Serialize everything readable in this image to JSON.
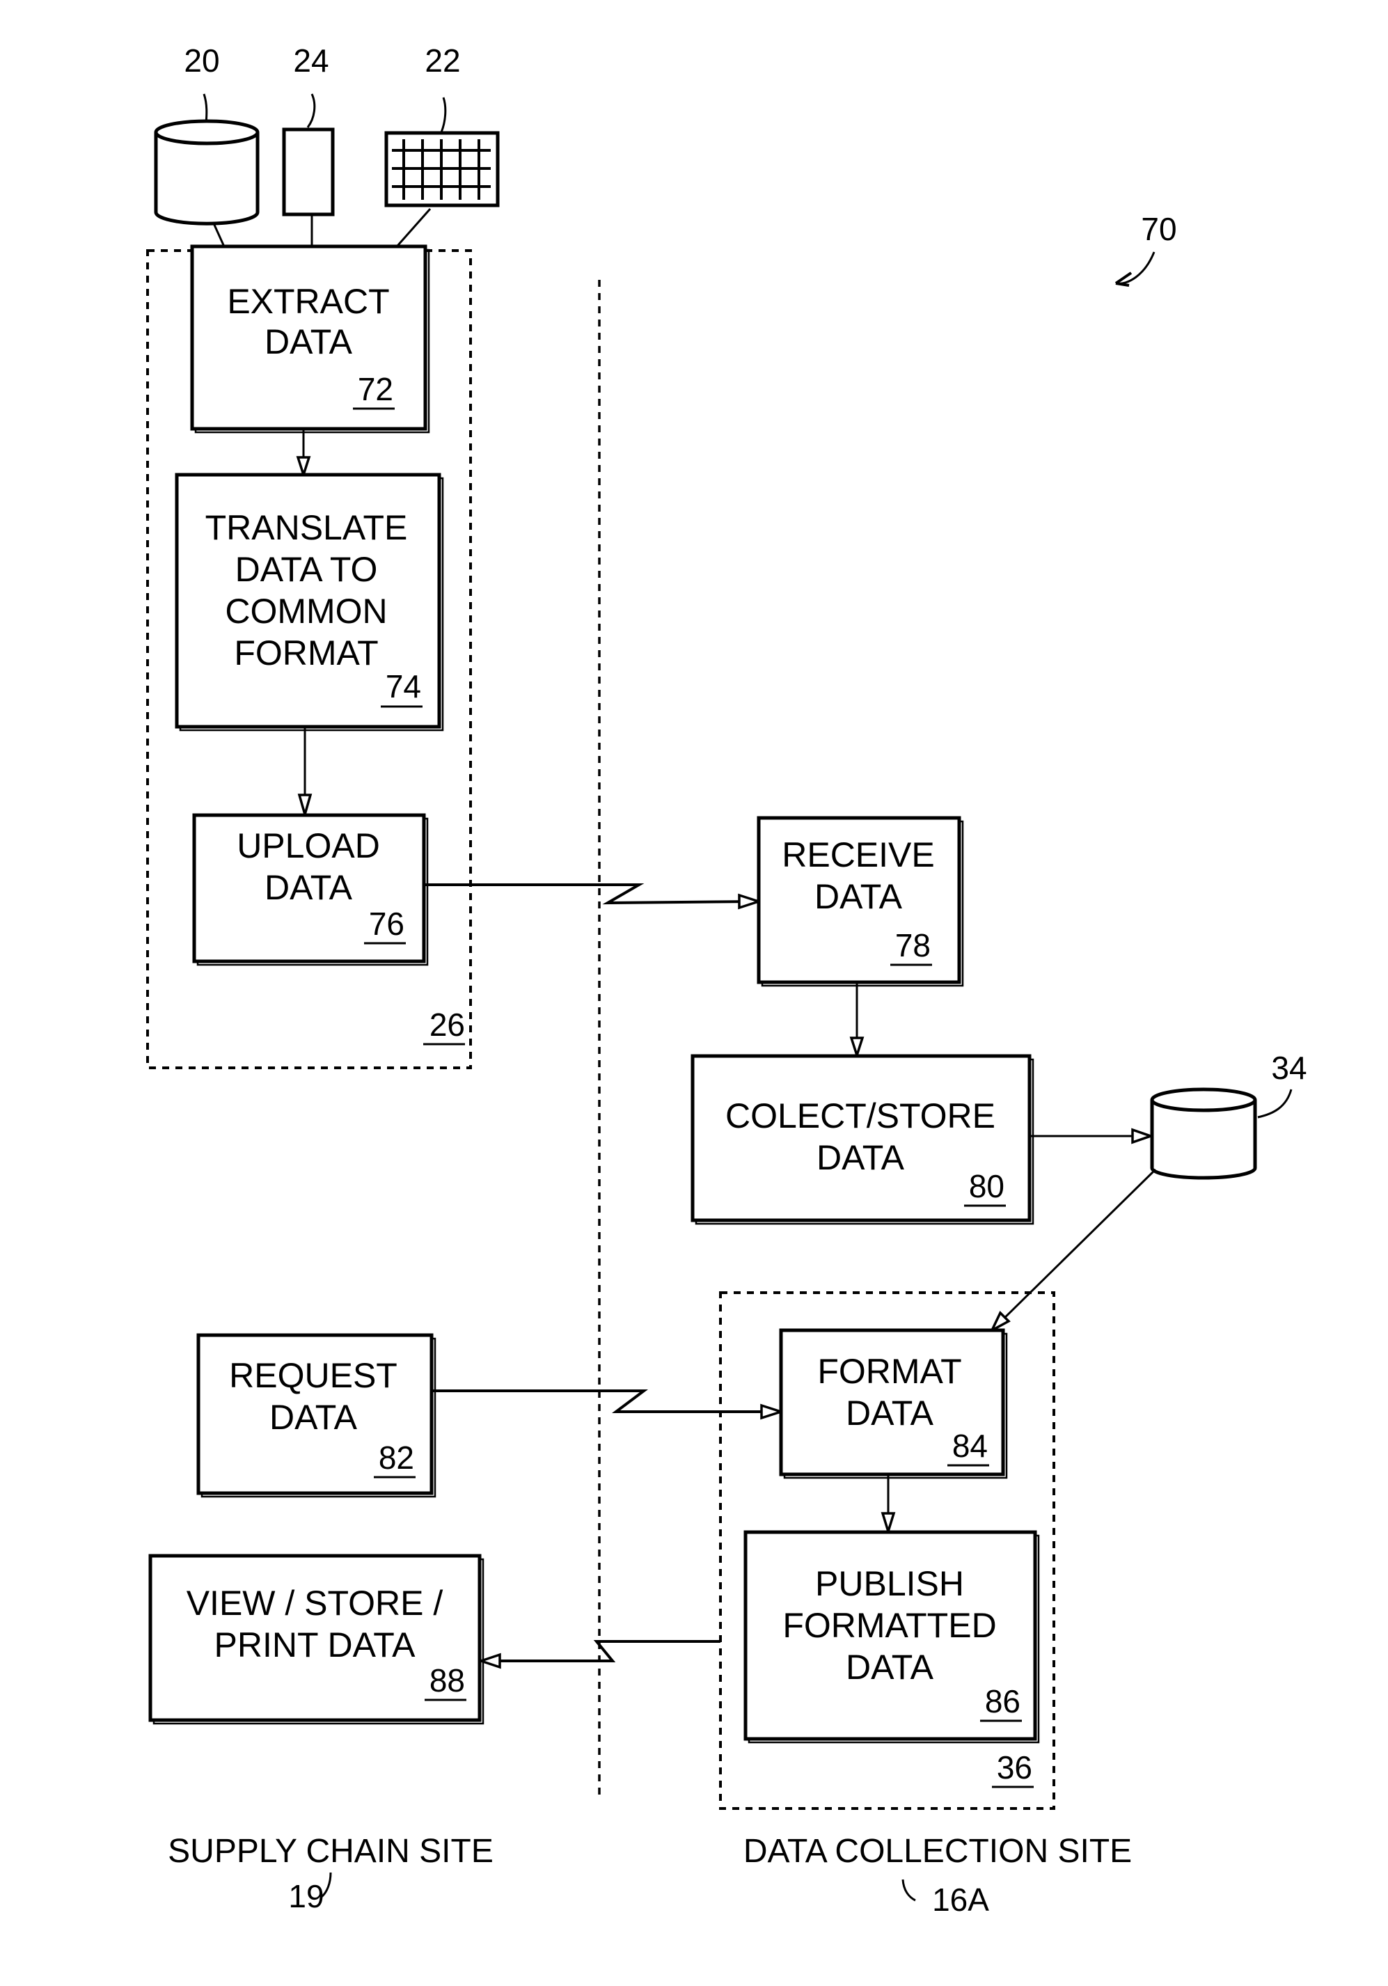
{
  "figure": {
    "ref": "70",
    "sources": [
      {
        "ref": "20",
        "icon": "database-cylinder-icon"
      },
      {
        "ref": "24",
        "icon": "document-rect-icon"
      },
      {
        "ref": "22",
        "icon": "grid-spreadsheet-icon"
      }
    ],
    "groups": {
      "supply_side_group": {
        "ref": "26"
      },
      "collection_group": {
        "ref": "36"
      }
    },
    "storage": {
      "ref": "34",
      "icon": "database-cylinder-icon"
    },
    "steps": {
      "extract": {
        "lines": [
          "EXTRACT",
          "DATA"
        ],
        "ref": "72"
      },
      "translate": {
        "lines": [
          "TRANSLATE",
          "DATA TO",
          "COMMON",
          "FORMAT"
        ],
        "ref": "74"
      },
      "upload": {
        "lines": [
          "UPLOAD",
          "DATA"
        ],
        "ref": "76"
      },
      "receive": {
        "lines": [
          "RECEIVE",
          "DATA"
        ],
        "ref": "78"
      },
      "collect": {
        "lines": [
          "COLECT/STORE",
          "DATA"
        ],
        "ref": "80"
      },
      "request": {
        "lines": [
          "REQUEST",
          "DATA"
        ],
        "ref": "82"
      },
      "format": {
        "lines": [
          "FORMAT",
          "DATA"
        ],
        "ref": "84"
      },
      "publish": {
        "lines": [
          "PUBLISH",
          "FORMATTED",
          "DATA"
        ],
        "ref": "86"
      },
      "view": {
        "lines": [
          "VIEW / STORE /",
          "PRINT DATA"
        ],
        "ref": "88"
      }
    },
    "sites": {
      "supply": {
        "label": "SUPPLY CHAIN SITE",
        "ref": "19"
      },
      "collection": {
        "label": "DATA COLLECTION SITE",
        "ref": "16A"
      }
    }
  }
}
